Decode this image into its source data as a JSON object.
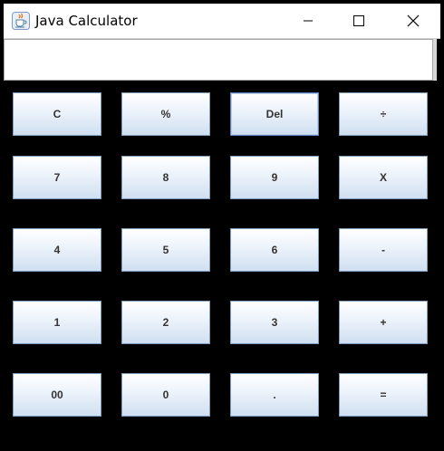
{
  "window": {
    "title": "Java Calculator",
    "icon": "java-cup-icon",
    "controls": {
      "minimize_icon": "minimize-icon",
      "maximize_icon": "maximize-icon",
      "close_icon": "close-icon"
    }
  },
  "display": {
    "value": ""
  },
  "keypad": {
    "rows": [
      [
        "C",
        "%",
        "Del",
        "÷"
      ],
      [
        "7",
        "8",
        "9",
        "X"
      ],
      [
        "4",
        "5",
        "6",
        "-"
      ],
      [
        "1",
        "2",
        "3",
        "+"
      ],
      [
        "00",
        "0",
        ".",
        "="
      ]
    ]
  },
  "colors": {
    "background": "#000000",
    "button_top": "#ffffff",
    "button_bottom": "#cfdff0",
    "button_border": "#7f9db9",
    "button_text": "#333333"
  }
}
